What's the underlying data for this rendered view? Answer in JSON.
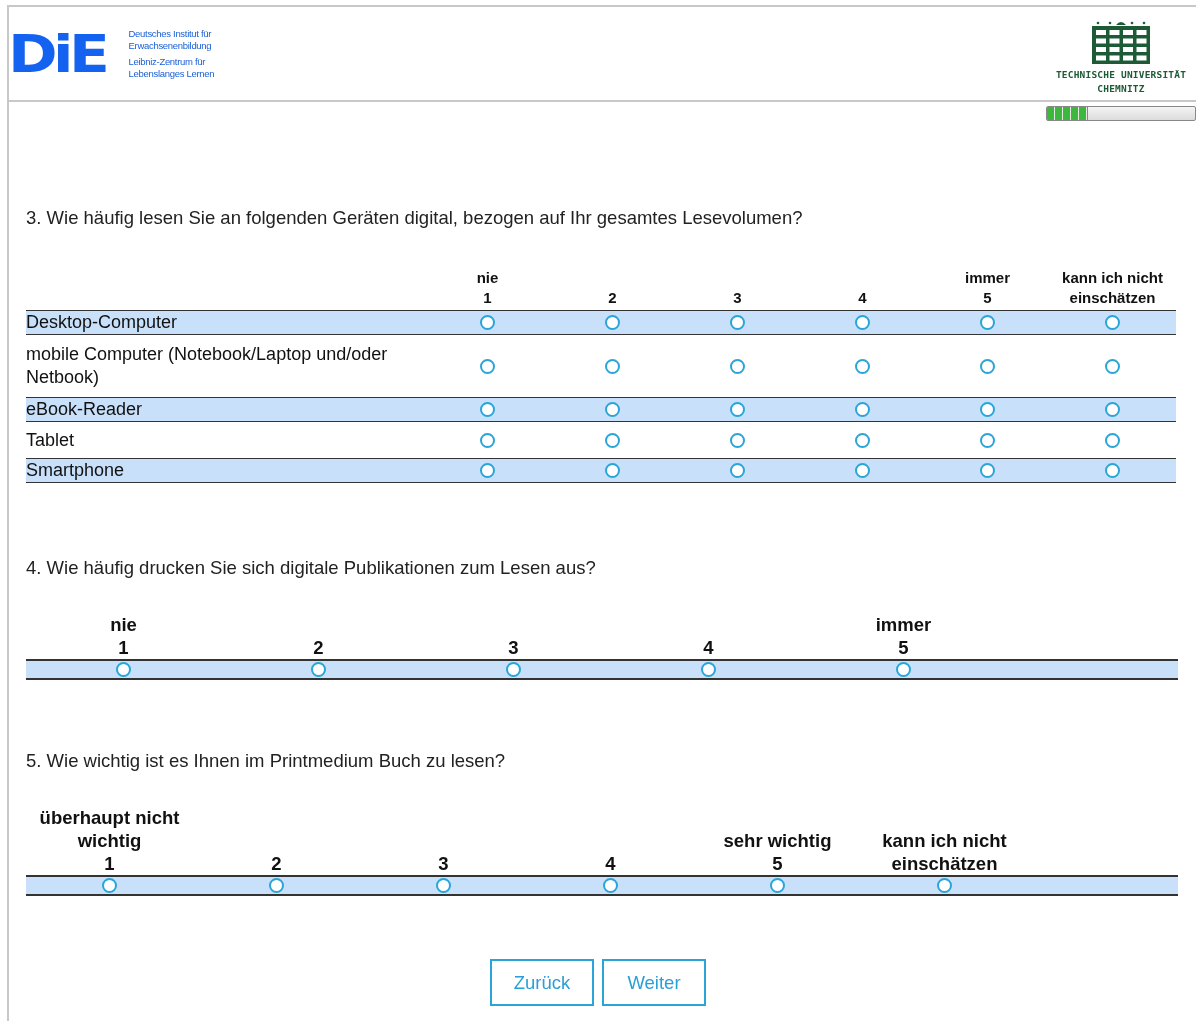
{
  "header": {
    "die_logo": "DiE",
    "die_lines": [
      "Deutsches Institut für",
      "Erwachsenenbildung",
      "Leibniz-Zentrum für",
      "Lebenslanges Lernen"
    ],
    "tu_lines": [
      "TECHNISCHE UNIVERSITÄT",
      "CHEMNITZ"
    ],
    "progress": {
      "level": 0.28
    }
  },
  "questions": [
    {
      "kind": "matrix",
      "text": "3. Wie häufig lesen Sie an folgenden Geräten digital, bezogen auf Ihr gesamtes Lesevolumen?",
      "columns": [
        {
          "label": "nie",
          "number": "1"
        },
        {
          "number": "2"
        },
        {
          "number": "3"
        },
        {
          "number": "4"
        },
        {
          "label": "immer",
          "number": "5"
        },
        {
          "label": "kann ich nicht einschätzen"
        }
      ],
      "rows": [
        {
          "label": "Desktop-Computer",
          "options": [
            {
              "selected": false
            },
            {
              "selected": false
            },
            {
              "selected": false
            },
            {
              "selected": false
            },
            {
              "selected": false
            },
            {
              "selected": false
            }
          ]
        },
        {
          "label": "mobile Computer (Notebook/Laptop und/oder Netbook)",
          "options": [
            {
              "selected": false
            },
            {
              "selected": false
            },
            {
              "selected": false
            },
            {
              "selected": false
            },
            {
              "selected": false
            },
            {
              "selected": false
            }
          ]
        },
        {
          "label": "eBook-Reader",
          "options": [
            {
              "selected": false
            },
            {
              "selected": false
            },
            {
              "selected": false
            },
            {
              "selected": false
            },
            {
              "selected": false
            },
            {
              "selected": false
            }
          ]
        },
        {
          "label": "Tablet",
          "options": [
            {
              "selected": false
            },
            {
              "selected": false
            },
            {
              "selected": false
            },
            {
              "selected": false
            },
            {
              "selected": false
            },
            {
              "selected": false
            }
          ]
        },
        {
          "label": "Smartphone",
          "options": [
            {
              "selected": false
            },
            {
              "selected": false
            },
            {
              "selected": false
            },
            {
              "selected": false
            },
            {
              "selected": false
            },
            {
              "selected": false
            }
          ]
        }
      ]
    },
    {
      "kind": "scale",
      "text": "4. Wie häufig drucken Sie sich digitale Publikationen zum Lesen aus?",
      "columns": [
        {
          "label": "nie",
          "number": "1",
          "selected": false
        },
        {
          "number": "2",
          "selected": false
        },
        {
          "number": "3",
          "selected": false
        },
        {
          "number": "4",
          "selected": false
        },
        {
          "label": "immer",
          "number": "5",
          "selected": false
        }
      ]
    },
    {
      "kind": "scale",
      "text": "5. Wie wichtig ist es Ihnen im Printmedium Buch zu lesen?",
      "columns": [
        {
          "label": "überhaupt nicht wichtig",
          "number": "1",
          "selected": false
        },
        {
          "number": "2",
          "selected": false
        },
        {
          "number": "3",
          "selected": false
        },
        {
          "number": "4",
          "selected": false
        },
        {
          "label": "sehr wichtig",
          "number": "5",
          "selected": false
        },
        {
          "label": "kann ich nicht einschätzen",
          "selected": false
        }
      ]
    }
  ],
  "buttons": [
    "Zurück",
    "Weiter"
  ]
}
